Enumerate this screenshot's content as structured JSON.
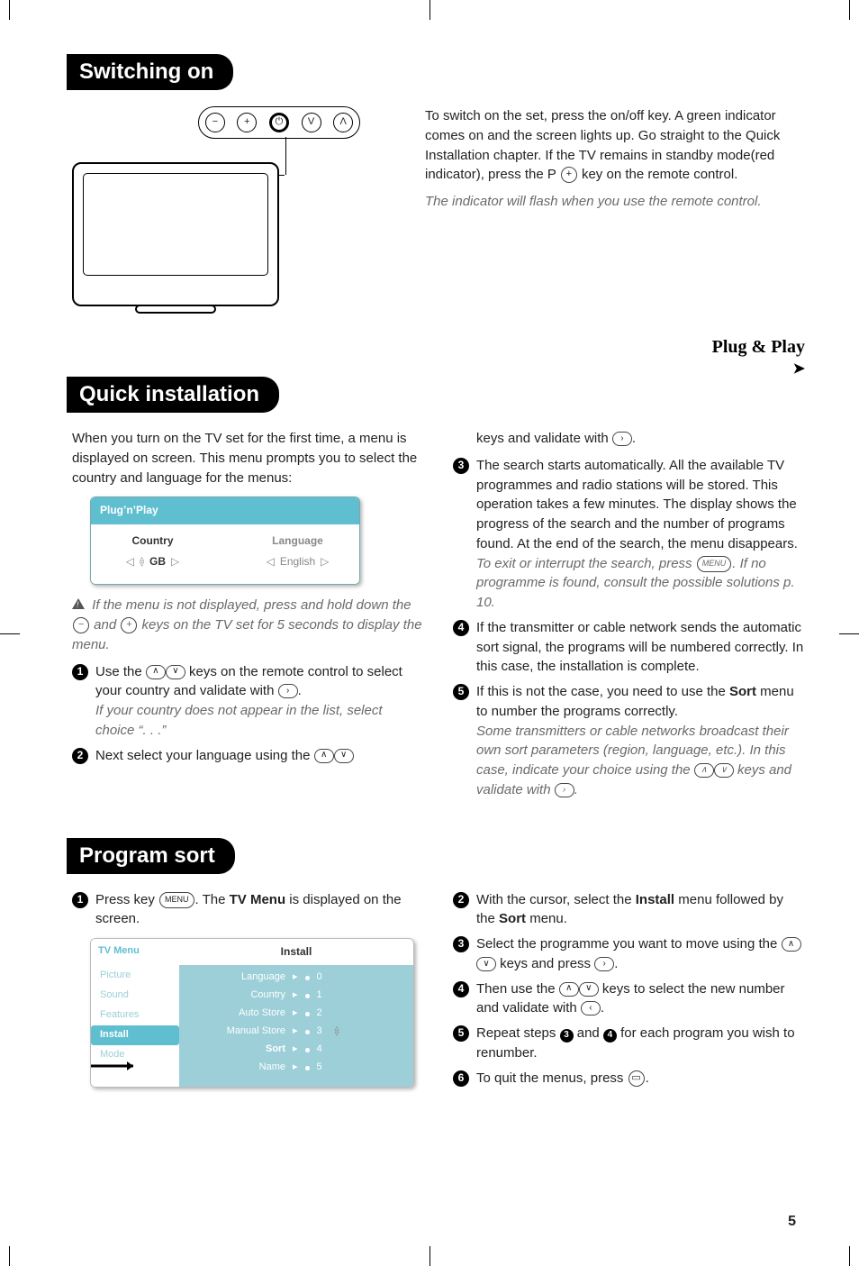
{
  "page_number": "5",
  "switching_on": {
    "title": "Switching on",
    "tv_buttons": [
      "−",
      "+",
      "⏻",
      "V",
      "Λ"
    ],
    "body1": "To switch on the set, press the on/off key.  A green indicator comes on and the screen lights up.  Go straight to the Quick Installation chapter. If the TV remains in standby mode(red indicator), press the P ",
    "body1_key": "+",
    "body1_tail": " key on the remote control.",
    "note": "The indicator will flash when you use the remote control."
  },
  "plugnplay": "Plug & Play",
  "quick": {
    "title": "Quick installation",
    "intro": "When you turn on the TV set for the first time, a menu is displayed on screen. This menu prompts you to select the country and language for the menus:",
    "osd": {
      "title": "Plug’n’Play",
      "country_label": "Country",
      "language_label": "Language",
      "country_value": "GB",
      "language_value": "English"
    },
    "warn_note_a": "If the menu is not displayed, press and hold down the ",
    "warn_key1": "−",
    "warn_mid": " and ",
    "warn_key2": "+",
    "warn_note_b": " keys on the TV set for 5 seconds to display the menu.",
    "step1_a": "Use the ",
    "step1_b": " keys on the remote control to select your country and validate with ",
    "step1_c": ".",
    "step1_note": "If your country does not appear in the list, select choice “. . .”",
    "step2": "Next select your language using the ",
    "step2_tail_a": "keys and validate with ",
    "step2_tail_b": ".",
    "step3_a": "The search starts automatically. All the available TV programmes and radio stations will be stored.  This operation takes a few minutes. The display shows the progress of the search and the number of programs found.  At the end of the search, the menu disappears.",
    "step3_note_a": "To exit or interrupt the search, press ",
    "step3_note_key": "MENU",
    "step3_note_b": ". If no programme is found, consult the possible solutions p. 10.",
    "step4": "If the transmitter or cable network sends the automatic sort signal, the programs will be numbered correctly. In this case, the installation is complete.",
    "step5_a": "If this is not the case, you need to use the ",
    "step5_bold": "Sort",
    "step5_b": " menu to number the programs correctly.",
    "step5_note_a": "Some transmitters or cable networks broadcast their own sort parameters (region, language, etc.). In this case, indicate your choice using the ",
    "step5_note_b": " keys and validate with ",
    "step5_note_c": "."
  },
  "program_sort": {
    "title": "Program sort",
    "step1_a": "Press key ",
    "step1_key": "MENU",
    "step1_b": ". The ",
    "step1_bold": "TV Menu",
    "step1_c": " is displayed on the screen.",
    "osd2": {
      "left_title": "TV Menu",
      "left_items": [
        "Picture",
        "Sound",
        "Features",
        "Install",
        "Mode"
      ],
      "left_selected": "Install",
      "right_title": "Install",
      "right_items": [
        {
          "label": "Language",
          "val": "0"
        },
        {
          "label": "Country",
          "val": "1"
        },
        {
          "label": "Auto Store",
          "val": "2"
        },
        {
          "label": "Manual Store",
          "val": "3",
          "sel": false
        },
        {
          "label": "Sort",
          "val": "4",
          "sel": true,
          "showval": "3"
        },
        {
          "label": "Name",
          "val": "5"
        }
      ]
    },
    "step2_a": "With the cursor, select the ",
    "step2_bold1": "Install",
    "step2_b": " menu followed by the ",
    "step2_bold2": "Sort",
    "step2_c": " menu.",
    "step3_a": "Select the programme you want to move using the ",
    "step3_b": " keys and press ",
    "step3_c": ".",
    "step4_a": "Then use the ",
    "step4_b": " keys to select the new number and validate with ",
    "step4_c": ".",
    "step5_a": "Repeat steps ",
    "step5_b": " and ",
    "step5_c": " for each program you wish to renumber.",
    "step6_a": "To quit the menus, press ",
    "step6_key": "▭",
    "step6_b": "."
  }
}
